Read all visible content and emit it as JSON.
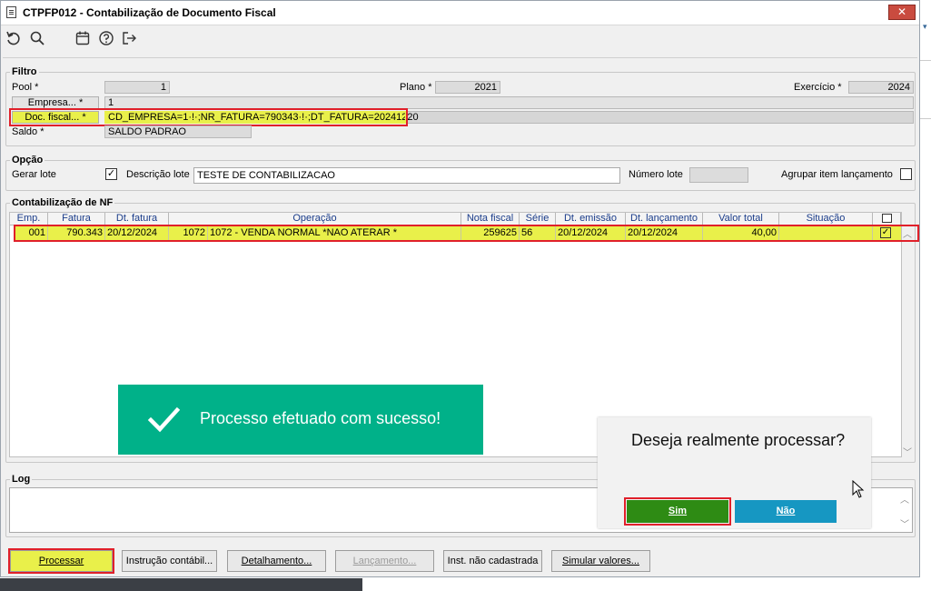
{
  "window": {
    "title": "CTPFP012 - Contabilização de Documento Fiscal",
    "close_glyph": "✕"
  },
  "toolbar": {
    "undo_icon": "undo-icon",
    "search_icon": "search-icon",
    "calendar_icon": "calendar-icon",
    "help_icon": "help-icon",
    "exit_icon": "exit-icon"
  },
  "filtro": {
    "legend": "Filtro",
    "pool_label": "Pool *",
    "pool_value": "1",
    "plano_label": "Plano *",
    "plano_value": "2021",
    "exercicio_label": "Exercício *",
    "exercicio_value": "2024",
    "empresa_label": "Empresa... *",
    "empresa_value": "1",
    "doc_fiscal_label": "Doc. fiscal... *",
    "doc_fiscal_value": "CD_EMPRESA=1·!·;NR_FATURA=790343·!·;DT_FATURA=20241220",
    "saldo_label": "Saldo *",
    "saldo_value": "SALDO PADRAO"
  },
  "opcao": {
    "legend": "Opção",
    "gerar_lote_label": "Gerar lote",
    "gerar_lote_checked": "✓",
    "descricao_lote_label": "Descrição lote",
    "descricao_lote_value": "TESTE DE CONTABILIZACAO",
    "numero_lote_label": "Número lote",
    "numero_lote_value": "",
    "agrupar_label": "Agrupar item lançamento",
    "agrupar_checked": ""
  },
  "grid": {
    "legend": "Contabilização de NF",
    "columns": [
      "Emp.",
      "Fatura",
      "Dt. fatura",
      "Operação",
      "Nota fiscal",
      "Série",
      "Dt. emissão",
      "Dt. lançamento",
      "Valor total",
      "Situação"
    ],
    "header_checkbox": "",
    "rows": [
      {
        "emp": "001",
        "fatura": "790.343",
        "dt_fatura": "20/12/2024",
        "op_code": "1072",
        "operacao": "1072 - VENDA NORMAL  *NAO ATERAR *",
        "nota_fiscal": "259625",
        "serie": "56",
        "dt_emissao": "20/12/2024",
        "dt_lancamento": "20/12/2024",
        "valor_total": "40,00",
        "situacao": "",
        "checked": "✓"
      }
    ]
  },
  "log": {
    "legend": "Log",
    "text": ""
  },
  "buttons": {
    "processar": "Processar",
    "instrucao": "Instrução contábil...",
    "detalhamento": "Detalhamento...",
    "lancamento": "Lançamento...",
    "inst_nao_cadastrada": "Inst. não cadastrada",
    "simular": "Simular valores..."
  },
  "toast": {
    "message": "Processo efetuado com sucesso!",
    "color": "#00b189"
  },
  "dialog": {
    "question": "Deseja realmente processar?",
    "yes": "Sim",
    "no": "Não",
    "yes_color": "#2e8b14",
    "no_color": "#1697c2"
  },
  "colors": {
    "highlight_row": "#e9f04a",
    "annotation_red": "#e0202a"
  }
}
